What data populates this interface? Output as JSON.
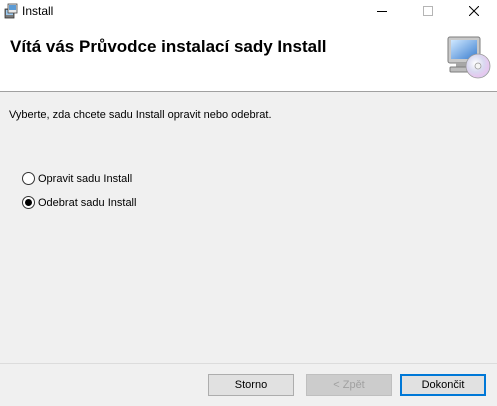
{
  "window": {
    "title": "Install"
  },
  "title_buttons": {
    "minimize_icon": "minimize-icon",
    "maximize_icon": "maximize-icon",
    "close_icon": "close-icon"
  },
  "banner": {
    "title": "Vítá vás Průvodce instalací sady Install",
    "icon": "computer-cd-icon"
  },
  "instruction": "Vyberte, zda chcete sadu Install opravit nebo odebrat.",
  "options": [
    {
      "label": "Opravit sadu Install",
      "selected": false
    },
    {
      "label": "Odebrat sadu Install",
      "selected": true
    }
  ],
  "buttons": {
    "cancel": "Storno",
    "back": "< Zpět",
    "finish": "Dokončit"
  },
  "colors": {
    "accent": "#0078d7",
    "background": "#f0f0f0"
  }
}
